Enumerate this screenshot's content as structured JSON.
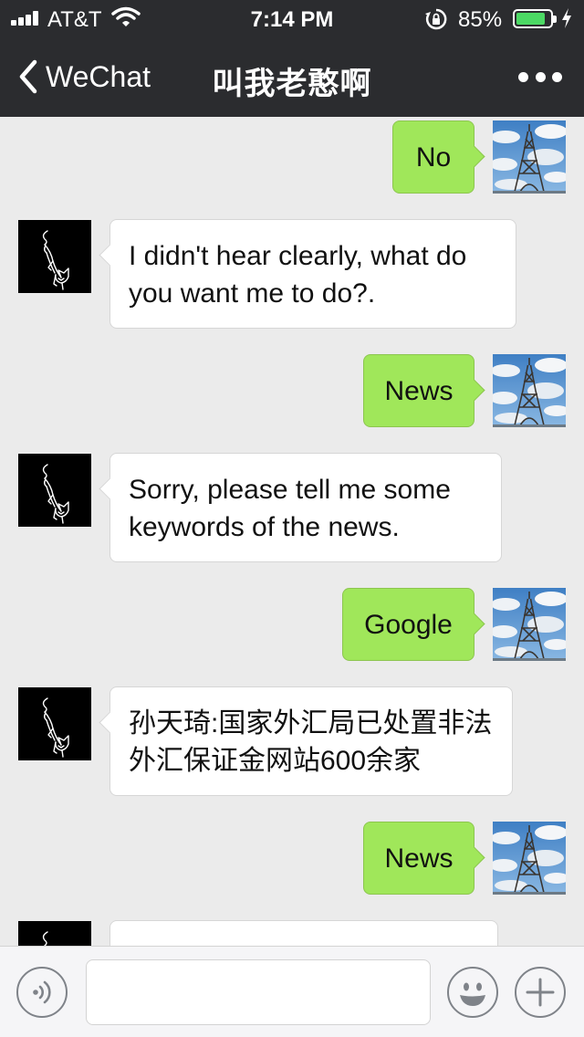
{
  "status_bar": {
    "carrier": "AT&T",
    "time": "7:14 PM",
    "battery_percent": "85%",
    "battery_level": 0.85
  },
  "nav": {
    "back_label": "WeChat",
    "title": "叫我老憨啊"
  },
  "messages": [
    {
      "side": "out",
      "text": "No"
    },
    {
      "side": "in",
      "text": "I didn't hear clearly, what do you want me to do?."
    },
    {
      "side": "out",
      "text": "News"
    },
    {
      "side": "in",
      "text": "Sorry, please tell me some keywords of the news."
    },
    {
      "side": "out",
      "text": "Google"
    },
    {
      "side": "in",
      "text": "孙天琦:国家外汇局已处置非法外汇保证金网站600余家"
    },
    {
      "side": "out",
      "text": "News"
    },
    {
      "side": "in",
      "text": ""
    }
  ],
  "input": {
    "value": "",
    "placeholder": ""
  },
  "colors": {
    "nav_background": "#2b2c2f",
    "chat_background": "#ebebeb",
    "outgoing_bubble": "#a0e75a",
    "incoming_bubble": "#ffffff",
    "battery_fill": "#4cd964"
  },
  "icons": {
    "signal": "cellular-signal-icon",
    "wifi": "wifi-icon",
    "rotation_lock": "rotation-lock-icon",
    "battery": "battery-icon",
    "charging": "charging-bolt-icon",
    "back": "chevron-left-icon",
    "more": "more-dots-icon",
    "voice": "voice-icon",
    "emoji": "emoji-icon",
    "plus": "plus-icon",
    "my_avatar": "eiffel-tower-avatar",
    "bot_avatar": "cat-line-drawing-avatar"
  }
}
